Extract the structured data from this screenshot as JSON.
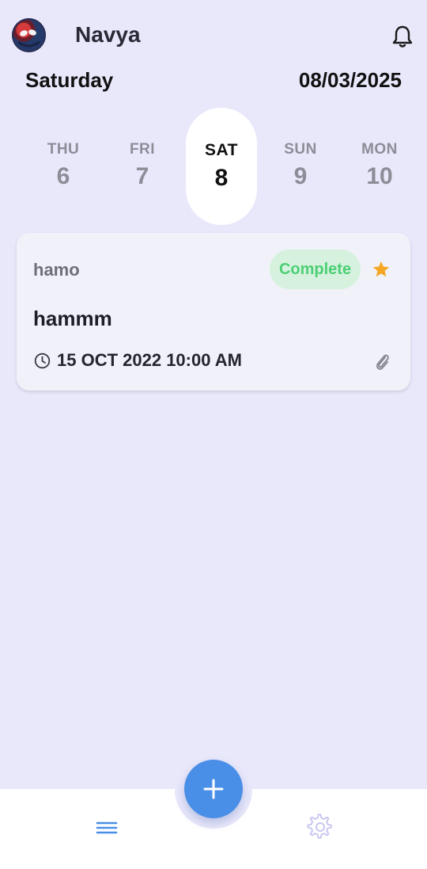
{
  "header": {
    "username": "Navya"
  },
  "summary": {
    "day_name": "Saturday",
    "date": "08/03/2025"
  },
  "days": [
    {
      "name": "THU",
      "num": "6"
    },
    {
      "name": "FRI",
      "num": "7"
    },
    {
      "name": "SAT",
      "num": "8"
    },
    {
      "name": "SUN",
      "num": "9"
    },
    {
      "name": "MON",
      "num": "10"
    }
  ],
  "selected_day_index": 2,
  "task": {
    "category": "hamo",
    "status": "Complete",
    "title": "hammm",
    "datetime": "15 OCT 2022 10:00 AM",
    "starred": true
  },
  "colors": {
    "background": "#e9e8fb",
    "accent": "#4a8fe7",
    "complete_text": "#4ccf74",
    "complete_bg": "#d6f2df",
    "star": "#f5a623"
  },
  "icons": {
    "notification": "bell-icon",
    "star": "star-icon",
    "time": "clock-icon",
    "attachment": "paperclip-icon",
    "add": "plus-icon",
    "menu": "menu-icon",
    "settings": "gear-icon"
  }
}
